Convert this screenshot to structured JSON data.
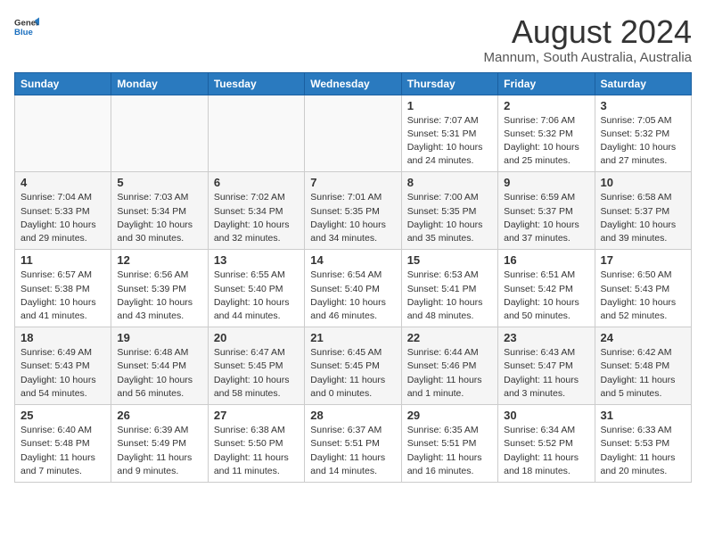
{
  "header": {
    "logo_general": "General",
    "logo_blue": "Blue",
    "title": "August 2024",
    "subtitle": "Mannum, South Australia, Australia"
  },
  "days_of_week": [
    "Sunday",
    "Monday",
    "Tuesday",
    "Wednesday",
    "Thursday",
    "Friday",
    "Saturday"
  ],
  "weeks": [
    [
      {
        "day": "",
        "info": ""
      },
      {
        "day": "",
        "info": ""
      },
      {
        "day": "",
        "info": ""
      },
      {
        "day": "",
        "info": ""
      },
      {
        "day": "1",
        "info": "Sunrise: 7:07 AM\nSunset: 5:31 PM\nDaylight: 10 hours\nand 24 minutes."
      },
      {
        "day": "2",
        "info": "Sunrise: 7:06 AM\nSunset: 5:32 PM\nDaylight: 10 hours\nand 25 minutes."
      },
      {
        "day": "3",
        "info": "Sunrise: 7:05 AM\nSunset: 5:32 PM\nDaylight: 10 hours\nand 27 minutes."
      }
    ],
    [
      {
        "day": "4",
        "info": "Sunrise: 7:04 AM\nSunset: 5:33 PM\nDaylight: 10 hours\nand 29 minutes."
      },
      {
        "day": "5",
        "info": "Sunrise: 7:03 AM\nSunset: 5:34 PM\nDaylight: 10 hours\nand 30 minutes."
      },
      {
        "day": "6",
        "info": "Sunrise: 7:02 AM\nSunset: 5:34 PM\nDaylight: 10 hours\nand 32 minutes."
      },
      {
        "day": "7",
        "info": "Sunrise: 7:01 AM\nSunset: 5:35 PM\nDaylight: 10 hours\nand 34 minutes."
      },
      {
        "day": "8",
        "info": "Sunrise: 7:00 AM\nSunset: 5:35 PM\nDaylight: 10 hours\nand 35 minutes."
      },
      {
        "day": "9",
        "info": "Sunrise: 6:59 AM\nSunset: 5:37 PM\nDaylight: 10 hours\nand 37 minutes."
      },
      {
        "day": "10",
        "info": "Sunrise: 6:58 AM\nSunset: 5:37 PM\nDaylight: 10 hours\nand 39 minutes."
      }
    ],
    [
      {
        "day": "11",
        "info": "Sunrise: 6:57 AM\nSunset: 5:38 PM\nDaylight: 10 hours\nand 41 minutes."
      },
      {
        "day": "12",
        "info": "Sunrise: 6:56 AM\nSunset: 5:39 PM\nDaylight: 10 hours\nand 43 minutes."
      },
      {
        "day": "13",
        "info": "Sunrise: 6:55 AM\nSunset: 5:40 PM\nDaylight: 10 hours\nand 44 minutes."
      },
      {
        "day": "14",
        "info": "Sunrise: 6:54 AM\nSunset: 5:40 PM\nDaylight: 10 hours\nand 46 minutes."
      },
      {
        "day": "15",
        "info": "Sunrise: 6:53 AM\nSunset: 5:41 PM\nDaylight: 10 hours\nand 48 minutes."
      },
      {
        "day": "16",
        "info": "Sunrise: 6:51 AM\nSunset: 5:42 PM\nDaylight: 10 hours\nand 50 minutes."
      },
      {
        "day": "17",
        "info": "Sunrise: 6:50 AM\nSunset: 5:43 PM\nDaylight: 10 hours\nand 52 minutes."
      }
    ],
    [
      {
        "day": "18",
        "info": "Sunrise: 6:49 AM\nSunset: 5:43 PM\nDaylight: 10 hours\nand 54 minutes."
      },
      {
        "day": "19",
        "info": "Sunrise: 6:48 AM\nSunset: 5:44 PM\nDaylight: 10 hours\nand 56 minutes."
      },
      {
        "day": "20",
        "info": "Sunrise: 6:47 AM\nSunset: 5:45 PM\nDaylight: 10 hours\nand 58 minutes."
      },
      {
        "day": "21",
        "info": "Sunrise: 6:45 AM\nSunset: 5:45 PM\nDaylight: 11 hours\nand 0 minutes."
      },
      {
        "day": "22",
        "info": "Sunrise: 6:44 AM\nSunset: 5:46 PM\nDaylight: 11 hours\nand 1 minute."
      },
      {
        "day": "23",
        "info": "Sunrise: 6:43 AM\nSunset: 5:47 PM\nDaylight: 11 hours\nand 3 minutes."
      },
      {
        "day": "24",
        "info": "Sunrise: 6:42 AM\nSunset: 5:48 PM\nDaylight: 11 hours\nand 5 minutes."
      }
    ],
    [
      {
        "day": "25",
        "info": "Sunrise: 6:40 AM\nSunset: 5:48 PM\nDaylight: 11 hours\nand 7 minutes."
      },
      {
        "day": "26",
        "info": "Sunrise: 6:39 AM\nSunset: 5:49 PM\nDaylight: 11 hours\nand 9 minutes."
      },
      {
        "day": "27",
        "info": "Sunrise: 6:38 AM\nSunset: 5:50 PM\nDaylight: 11 hours\nand 11 minutes."
      },
      {
        "day": "28",
        "info": "Sunrise: 6:37 AM\nSunset: 5:51 PM\nDaylight: 11 hours\nand 14 minutes."
      },
      {
        "day": "29",
        "info": "Sunrise: 6:35 AM\nSunset: 5:51 PM\nDaylight: 11 hours\nand 16 minutes."
      },
      {
        "day": "30",
        "info": "Sunrise: 6:34 AM\nSunset: 5:52 PM\nDaylight: 11 hours\nand 18 minutes."
      },
      {
        "day": "31",
        "info": "Sunrise: 6:33 AM\nSunset: 5:53 PM\nDaylight: 11 hours\nand 20 minutes."
      }
    ]
  ]
}
